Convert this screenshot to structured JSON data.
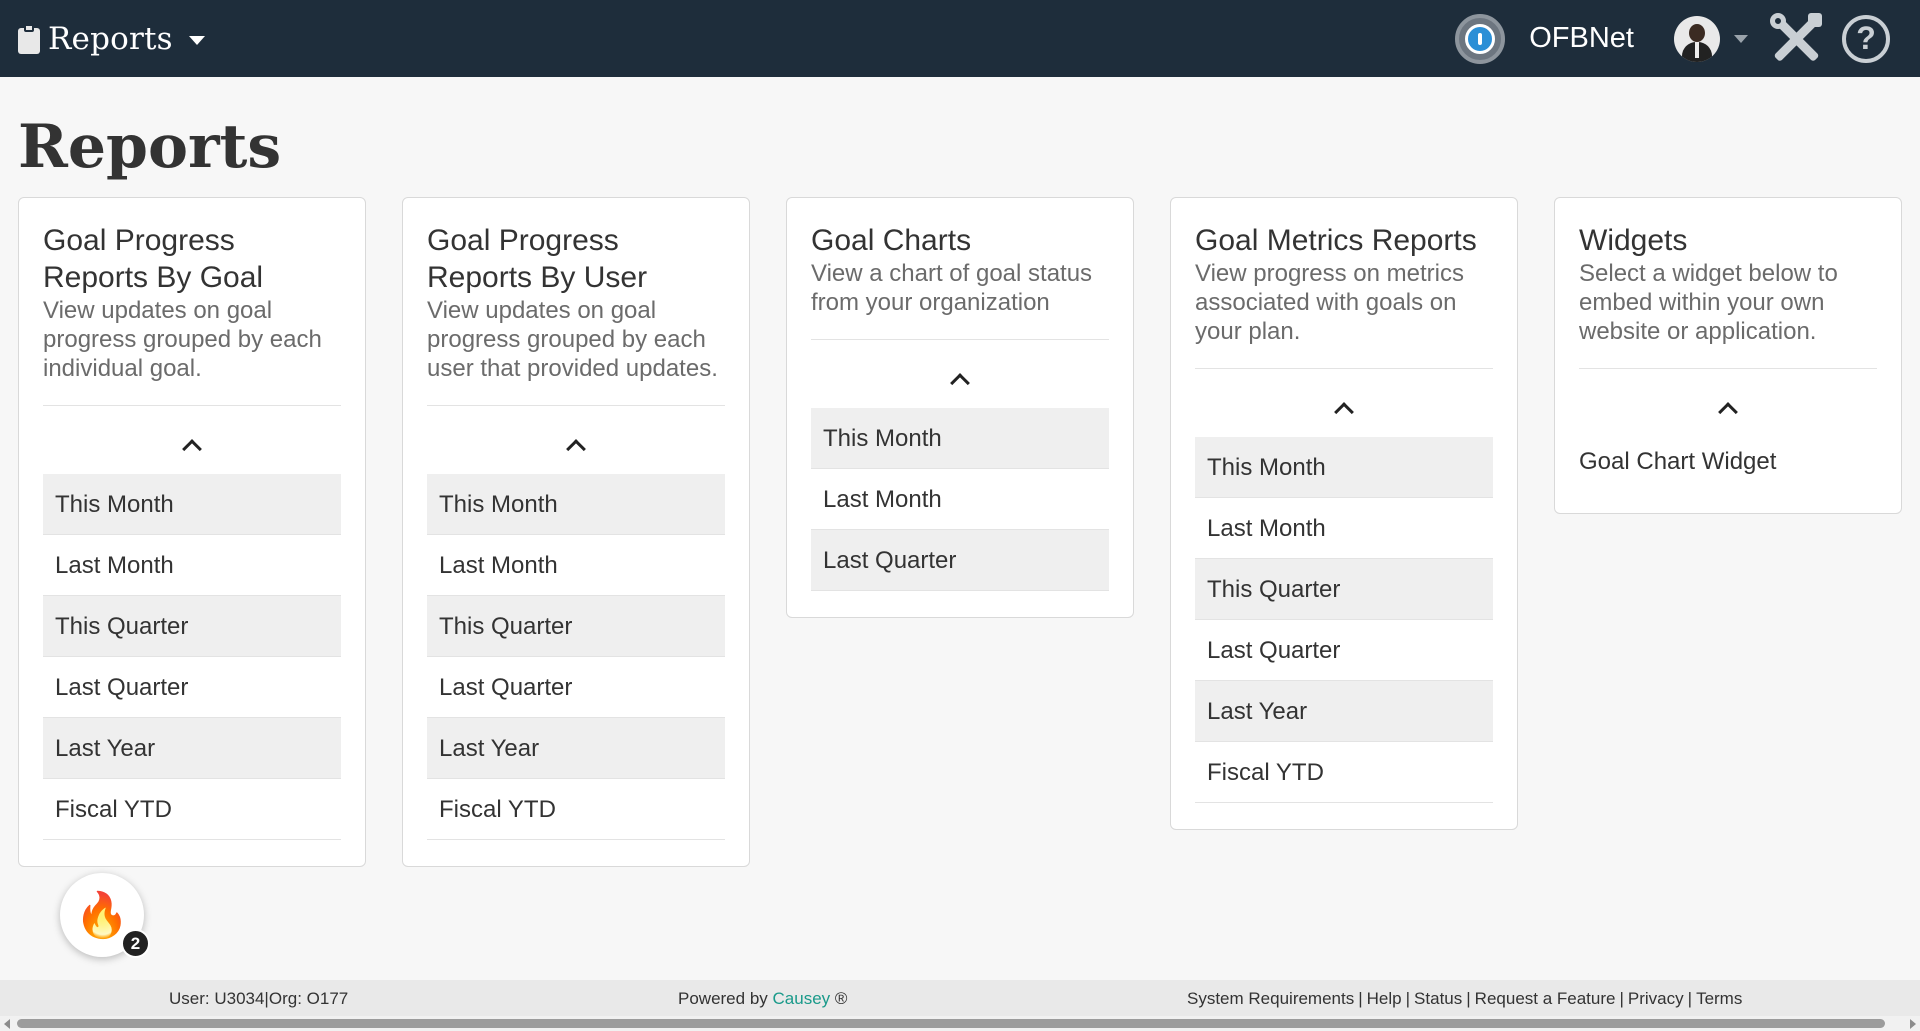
{
  "navbar": {
    "title": "Reports",
    "org_name": "OFBNet",
    "icons": [
      "clipboard-icon",
      "org-logo-icon",
      "tools-icon",
      "help-icon"
    ],
    "help_glyph": "?"
  },
  "page": {
    "title": "Reports"
  },
  "cards": [
    {
      "title": "Goal Progress Reports By Goal",
      "description": "View updates on goal progress grouped by each individual goal.",
      "items": [
        "This Month",
        "Last Month",
        "This Quarter",
        "Last Quarter",
        "Last Year",
        "Fiscal YTD"
      ]
    },
    {
      "title": "Goal Progress Reports By User",
      "description": "View updates on goal progress grouped by each user that provided updates.",
      "items": [
        "This Month",
        "Last Month",
        "This Quarter",
        "Last Quarter",
        "Last Year",
        "Fiscal YTD"
      ]
    },
    {
      "title": "Goal Charts",
      "description": "View a chart of goal status from your organization",
      "items": [
        "This Month",
        "Last Month",
        "Last Quarter"
      ]
    },
    {
      "title": "Goal Metrics Reports",
      "description": "View progress on metrics associated with goals on your plan.",
      "items": [
        "This Month",
        "Last Month",
        "This Quarter",
        "Last Quarter",
        "Last Year",
        "Fiscal YTD"
      ]
    },
    {
      "title": "Widgets",
      "description": "Select a widget below to embed within your own website or application.",
      "items": [
        "Goal Chart Widget"
      ]
    }
  ],
  "badge": {
    "icon": "fire-icon",
    "count": "2"
  },
  "footer": {
    "user": "User: U3034|Org: O177",
    "powered_prefix": "Powered by",
    "powered_link": "Causey",
    "powered_suffix": "®",
    "links": [
      "System Requirements",
      "Help",
      "Status",
      "Request a Feature",
      "Privacy",
      "Terms"
    ],
    "separator": "|"
  },
  "colors": {
    "navbar": "#1e2d3b",
    "link": "#1a9a8a",
    "row_alt": "#efefef"
  }
}
